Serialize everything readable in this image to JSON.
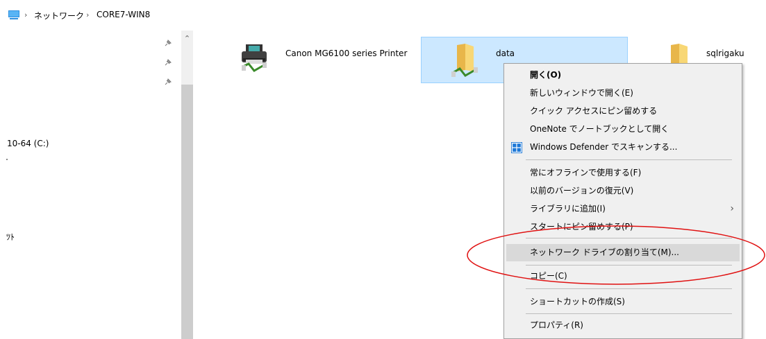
{
  "breadcrumb": {
    "items": [
      {
        "label": "ネットワーク"
      },
      {
        "label": "CORE7-WIN8"
      }
    ]
  },
  "navigation": {
    "items": [
      {
        "label": "10-64 (C:)"
      },
      {
        "label": "ﾂﾄ"
      }
    ]
  },
  "content": {
    "items": [
      {
        "label": "Canon MG6100 series Printer",
        "icon": "printer-icon"
      },
      {
        "label": "data",
        "icon": "network-folder-icon",
        "selected": true
      },
      {
        "label": "sqlrigaku",
        "icon": "network-folder-icon"
      }
    ]
  },
  "context_menu": {
    "items": [
      {
        "label": "開く(O)",
        "bold": true
      },
      {
        "label": "新しいウィンドウで開く(E)"
      },
      {
        "label": "クイック アクセスにピン留めする"
      },
      {
        "label": "OneNote でノートブックとして開く"
      },
      {
        "label": "Windows Defender でスキャンする...",
        "icon": "windows-defender-icon"
      },
      {
        "label": "常にオフラインで使用する(F)"
      },
      {
        "label": "以前のバージョンの復元(V)"
      },
      {
        "label": "ライブラリに追加(I)",
        "submenu_arrow": "›"
      },
      {
        "label": "スタートにピン留めする(P)"
      },
      {
        "label": "ネットワーク ドライブの割り当て(M)...",
        "highlighted": true
      },
      {
        "label": "コピー(C)"
      },
      {
        "label": "ショートカットの作成(S)"
      },
      {
        "label": "プロパティ(R)"
      }
    ]
  },
  "colors": {
    "selection_bg": "#cce8ff",
    "selection_border": "#99d1ff",
    "menu_bg": "#f0f0f0",
    "menu_highlight": "#d9d9d9",
    "annotation_red": "#e01010",
    "folder_yellow": "#f8d775"
  }
}
